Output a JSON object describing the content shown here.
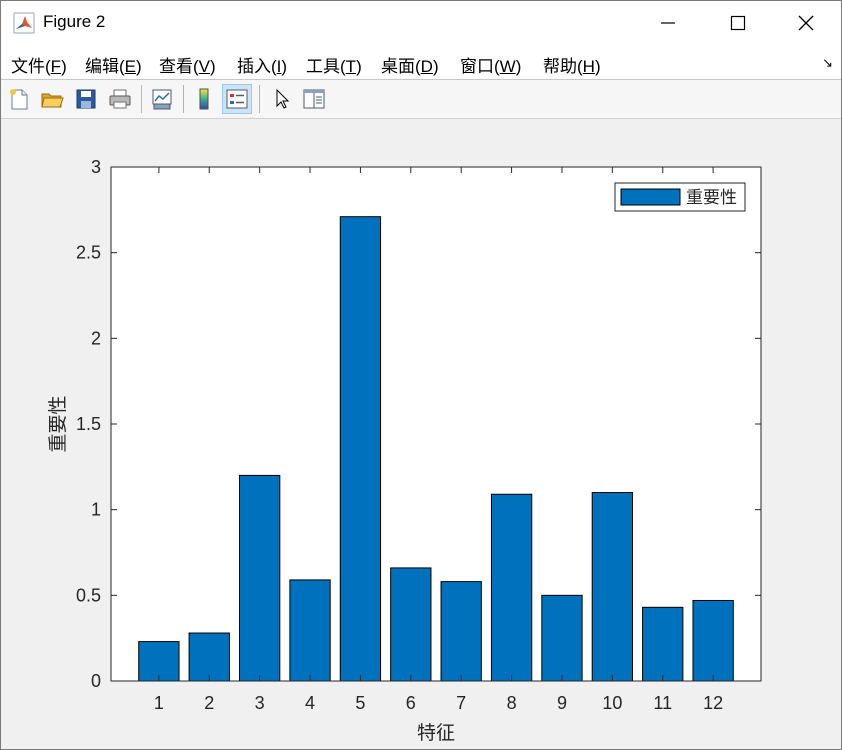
{
  "window": {
    "title": "Figure 2"
  },
  "menu": [
    {
      "label": "文件(",
      "key": "F",
      "end": ")"
    },
    {
      "label": "编辑(",
      "key": "E",
      "end": ")"
    },
    {
      "label": "查看(",
      "key": "V",
      "end": ")"
    },
    {
      "label": "插入(",
      "key": "I",
      "end": ")"
    },
    {
      "label": "工具(",
      "key": "T",
      "end": ")"
    },
    {
      "label": "桌面(",
      "key": "D",
      "end": ")"
    },
    {
      "label": "窗口(",
      "key": "W",
      "end": ")"
    },
    {
      "label": "帮助(",
      "key": "H",
      "end": ")"
    }
  ],
  "menu_arrow": "↘",
  "toolbar": {
    "icons": [
      "new-figure-icon",
      "open-file-icon",
      "save-icon",
      "print-icon",
      "link-plot-icon",
      "colorbar-icon",
      "legend-icon",
      "pointer-icon",
      "property-inspector-icon"
    ]
  },
  "colors": {
    "bar": "#0072bd",
    "axes_bg": "#ffffff",
    "figure_bg": "#f0f0f0"
  },
  "chart_data": {
    "type": "bar",
    "categories": [
      "1",
      "2",
      "3",
      "4",
      "5",
      "6",
      "7",
      "8",
      "9",
      "10",
      "11",
      "12"
    ],
    "series": [
      {
        "name": "重要性",
        "values": [
          0.23,
          0.28,
          1.2,
          0.59,
          2.71,
          0.66,
          0.58,
          1.09,
          0.5,
          1.1,
          0.43,
          0.47
        ]
      }
    ],
    "xlabel": "特征",
    "ylabel": "重要性",
    "ylim": [
      0,
      3
    ],
    "yticks": [
      0,
      0.5,
      1,
      1.5,
      2,
      2.5,
      3
    ],
    "ytick_labels": [
      "0",
      "0.5",
      "1",
      "1.5",
      "2",
      "2.5",
      "3"
    ],
    "legend_position": "top-right",
    "grid": false
  }
}
